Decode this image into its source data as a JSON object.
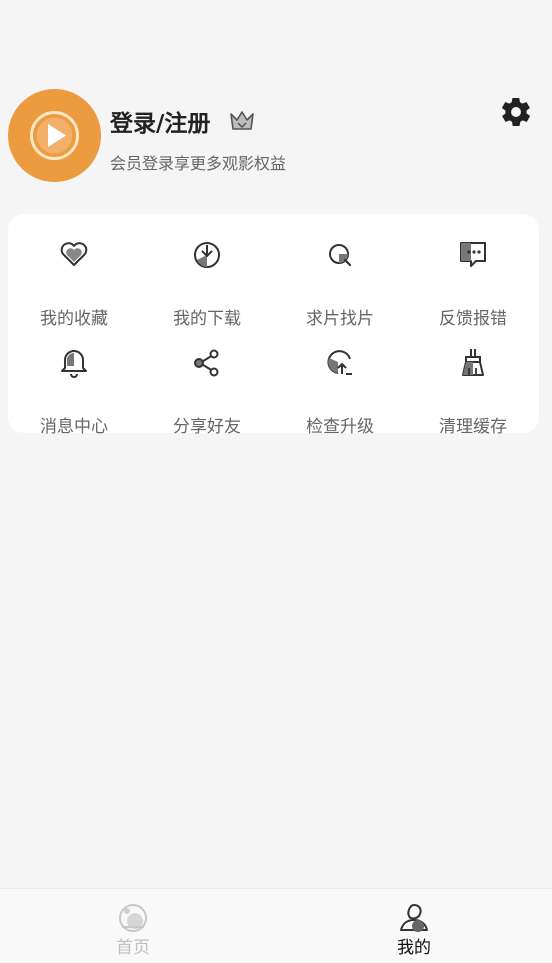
{
  "profile": {
    "title": "登录/注册",
    "subtitle": "会员登录享更多观影权益",
    "avatar_icon": "play-icon",
    "badge_icon": "crown-icon",
    "settings_icon": "gear-icon"
  },
  "grid": {
    "items": [
      {
        "label": "我的收藏",
        "icon": "heart-icon"
      },
      {
        "label": "我的下载",
        "icon": "download-icon"
      },
      {
        "label": "求片找片",
        "icon": "search-icon"
      },
      {
        "label": "反馈报错",
        "icon": "feedback-icon"
      },
      {
        "label": "消息中心",
        "icon": "bell-icon"
      },
      {
        "label": "分享好友",
        "icon": "share-icon"
      },
      {
        "label": "检查升级",
        "icon": "upgrade-icon"
      },
      {
        "label": "清理缓存",
        "icon": "broom-icon"
      }
    ]
  },
  "tabbar": {
    "tabs": [
      {
        "label": "首页",
        "icon": "home-icon",
        "active": false
      },
      {
        "label": "我的",
        "icon": "user-icon",
        "active": true
      }
    ]
  },
  "colors": {
    "accent": "#ec9b3e",
    "text_primary": "#222222",
    "text_secondary": "#666666",
    "tab_inactive": "#c0c0c0"
  }
}
